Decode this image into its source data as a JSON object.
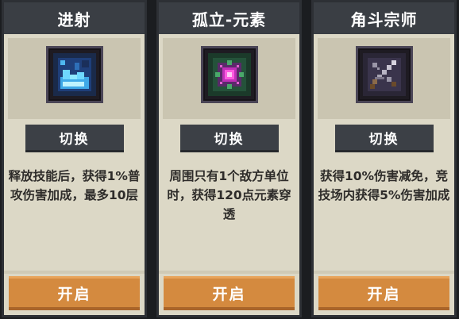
{
  "cards": [
    {
      "title": "进射",
      "icon": "splash-wave-icon",
      "switch_label": "切换",
      "description": "释放技能后，获得1%普攻伤害加成，最多10层",
      "open_label": "开启",
      "accent": "#5fd3ff"
    },
    {
      "title": "孤立-元素",
      "icon": "element-orb-icon",
      "switch_label": "切换",
      "description": "周围只有1个敌方单位时，获得120点元素穿透",
      "open_label": "开启",
      "accent": "#e040c8"
    },
    {
      "title": "角斗宗师",
      "icon": "crossed-swords-icon",
      "switch_label": "切换",
      "description": "获得10%伤害减免，竞技场内获得5%伤害加成",
      "open_label": "开启",
      "accent": "#b8b4c4"
    }
  ],
  "colors": {
    "header_bg": "#3a3e44",
    "card_bg": "#dcd8c6",
    "open_button": "#d48a3f"
  }
}
